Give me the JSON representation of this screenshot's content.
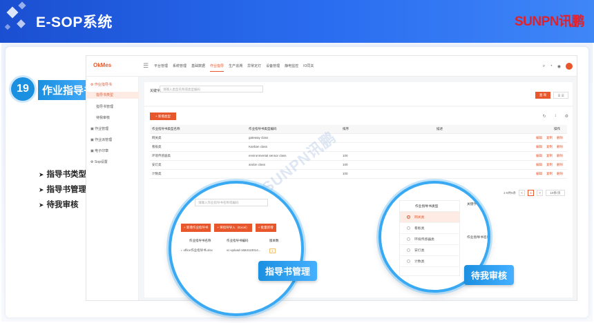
{
  "banner": {
    "title": "E-SOP系统",
    "logo_text": "SUNPN讯鹏"
  },
  "slide": {
    "number": "19",
    "feature_title": "作业指导书",
    "bullets": [
      "指导书类型",
      "指导书管理",
      "待我审核"
    ],
    "watermark": "SUNPN讯鹏"
  },
  "app": {
    "brand": "OkMes",
    "nav": [
      "平台管理",
      "系统管理",
      "基础数据",
      "作业指导",
      "生产追溯",
      "异常定灯",
      "设备管理",
      "静电监控",
      "IO同关"
    ],
    "nav_active_index": 3,
    "sidebar": {
      "groups": [
        {
          "label": "作业指导书",
          "active": true,
          "items": [
            "指导书类型",
            "指导书管理",
            "待我审核"
          ]
        },
        {
          "label": "作业管理"
        },
        {
          "label": "作业派管理"
        },
        {
          "label": "电子印章"
        },
        {
          "label": "Sop设置"
        }
      ],
      "selected": "指导书类型"
    },
    "filter": {
      "label": "关键字:",
      "placeholder": "请输入类型名称或类型编码",
      "query_button": "查 询"
    },
    "add_button": "+ 新增类型",
    "table": {
      "headers": [
        "作业指导书类型名称",
        "作业指导书类型编码",
        "排序",
        "描述",
        "操作"
      ],
      "rows": [
        {
          "name": "网关类",
          "code": "gateway class",
          "sort": "",
          "desc": ""
        },
        {
          "name": "看板类",
          "code": "Kanban class",
          "sort": "",
          "desc": ""
        },
        {
          "name": "环境传感器类",
          "code": "environmental sensor class",
          "sort": "100",
          "desc": ""
        },
        {
          "name": "安灯类",
          "code": "andon class",
          "sort": "100",
          "desc": ""
        },
        {
          "name": "计数类",
          "code": "",
          "sort": "100",
          "desc": ""
        }
      ],
      "ops": [
        "编辑",
        "复制",
        "删除"
      ]
    },
    "pager": {
      "total": "1-5共5条",
      "prev": "<",
      "page": "1",
      "next": ">",
      "size": "10条/页"
    }
  },
  "circle_manage": {
    "placeholder": "请输入作业指导书名称或编码",
    "buttons": [
      "+ 新增作业指导书",
      "+ 将指导导入（Excel）",
      "+ 批量新增"
    ],
    "headers": [
      "作业指导书名称",
      "作业指导书编码",
      "版本数"
    ],
    "row": {
      "name": "office作业指导书.xlsx",
      "code": "vc-upload-1684110014...",
      "version": "1"
    },
    "label": "指导书管理"
  },
  "circle_review": {
    "list_header": "作业指导书类型",
    "items": [
      "网关类",
      "看板类",
      "环境传感器类",
      "安灯类",
      "计数类"
    ],
    "selected_index": 0,
    "keyword_label": "关键字:",
    "col_header": "作业指导书名称",
    "label": "待我审核"
  }
}
